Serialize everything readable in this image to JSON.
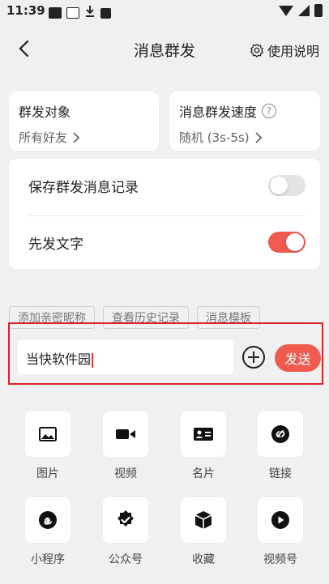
{
  "status_bar": {
    "time": "11:39"
  },
  "header": {
    "title": "消息群发",
    "help_label": "使用说明"
  },
  "target_card": {
    "title": "群发对象",
    "value": "所有好友"
  },
  "speed_card": {
    "title": "消息群发速度",
    "value": "随机 (3s-5s)"
  },
  "toggles": [
    {
      "label": "保存群发消息记录",
      "on": false
    },
    {
      "label": "先发文字",
      "on": true
    }
  ],
  "chips": [
    "添加亲密昵称",
    "查看历史记录",
    "消息模板"
  ],
  "compose": {
    "text": "当快软件园",
    "send_label": "发送"
  },
  "tools": [
    {
      "label": "图片",
      "icon": "image-icon"
    },
    {
      "label": "视频",
      "icon": "video-icon"
    },
    {
      "label": "名片",
      "icon": "business-card-icon"
    },
    {
      "label": "链接",
      "icon": "link-icon"
    },
    {
      "label": "小程序",
      "icon": "mini-program-icon"
    },
    {
      "label": "公众号",
      "icon": "official-account-icon"
    },
    {
      "label": "收藏",
      "icon": "favorites-icon"
    },
    {
      "label": "视频号",
      "icon": "video-channel-icon"
    }
  ],
  "colors": {
    "accent": "#f05a4f",
    "highlight_border": "#d8232a",
    "background": "#f0f0f0"
  }
}
